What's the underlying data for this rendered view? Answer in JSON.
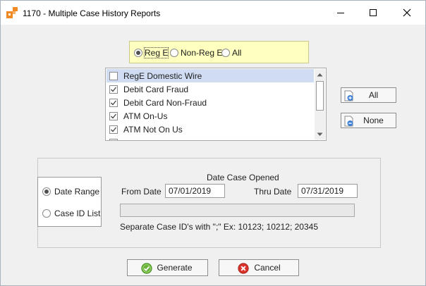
{
  "window": {
    "title": "1170 - Multiple Case History Reports"
  },
  "reg_filter": {
    "options": [
      {
        "label": "Reg E",
        "selected": true
      },
      {
        "label": "Non-Reg E",
        "selected": false
      },
      {
        "label": "All",
        "selected": false
      }
    ]
  },
  "case_types": {
    "items": [
      {
        "label": "RegE Domestic Wire",
        "checked": false,
        "selected": true
      },
      {
        "label": "Debit Card Fraud",
        "checked": true,
        "selected": false
      },
      {
        "label": "Debit Card Non-Fraud",
        "checked": true,
        "selected": false
      },
      {
        "label": "ATM On-Us",
        "checked": true,
        "selected": false
      },
      {
        "label": "ATM Not On Us",
        "checked": true,
        "selected": false
      }
    ],
    "all_label": "All",
    "none_label": "None"
  },
  "criteria": {
    "modes": [
      {
        "label": "Date Range",
        "selected": true
      },
      {
        "label": "Case ID List",
        "selected": false
      }
    ],
    "section_title": "Date Case Opened",
    "from_label": "From Date",
    "from_value": "07/01/2019",
    "thru_label": "Thru Date",
    "thru_value": "07/31/2019",
    "case_ids_value": "",
    "hint": "Separate Case ID's with \";\" Ex: 10123; 10212; 20345"
  },
  "actions": {
    "generate_label": "Generate",
    "cancel_label": "Cancel"
  },
  "colors": {
    "accent_orange": "#f08a24",
    "filter_bg": "#ffffbf",
    "selection": "#cfdcf2",
    "generate_green": "#6bb33a",
    "cancel_red": "#d9342b"
  },
  "icons": {
    "app": "app-logo-icon",
    "minimize": "minimize-icon",
    "maximize": "maximize-icon",
    "close": "close-icon",
    "select_all": "add-icon",
    "select_none": "remove-icon",
    "generate": "check-icon",
    "cancel": "cancel-icon"
  }
}
